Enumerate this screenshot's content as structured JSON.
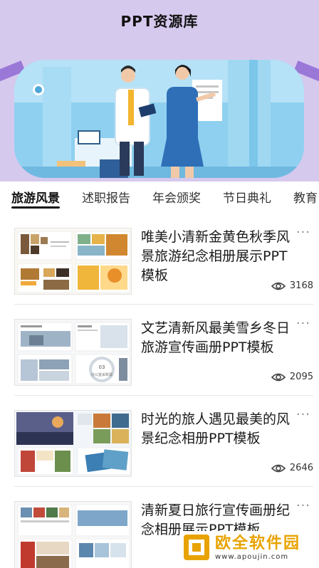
{
  "app": {
    "title": "PPT资源库"
  },
  "tabs": [
    {
      "label": "旅游风景",
      "active": true
    },
    {
      "label": "述职报告",
      "active": false
    },
    {
      "label": "年会颁奖",
      "active": false
    },
    {
      "label": "节日典礼",
      "active": false
    },
    {
      "label": "教育",
      "active": false
    }
  ],
  "cards": [
    {
      "title": "唯美小清新金黄色秋季风景旅游纪念相册展示PPT模板",
      "views": "3168"
    },
    {
      "title": "文艺清新风最美雪乡冬日旅游宣传画册PPT模板",
      "views": "2095"
    },
    {
      "title": "时光的旅人遇见最美的风景纪念相册PPT模板",
      "views": "2646"
    },
    {
      "title": "清新夏日旅行宣传画册纪念相册展示PPT模板",
      "views": ""
    }
  ],
  "more_glyph": "···",
  "thumb_text": {
    "card2_number": "03",
    "card2_caption": "办公室采新疆"
  },
  "watermark": {
    "main": "欧全软件园",
    "url": "www.apoujin.com"
  },
  "colors": {
    "header": "#d6c9ee",
    "accent_stripe": "#9a78d8",
    "watermark": "#e8a300"
  }
}
